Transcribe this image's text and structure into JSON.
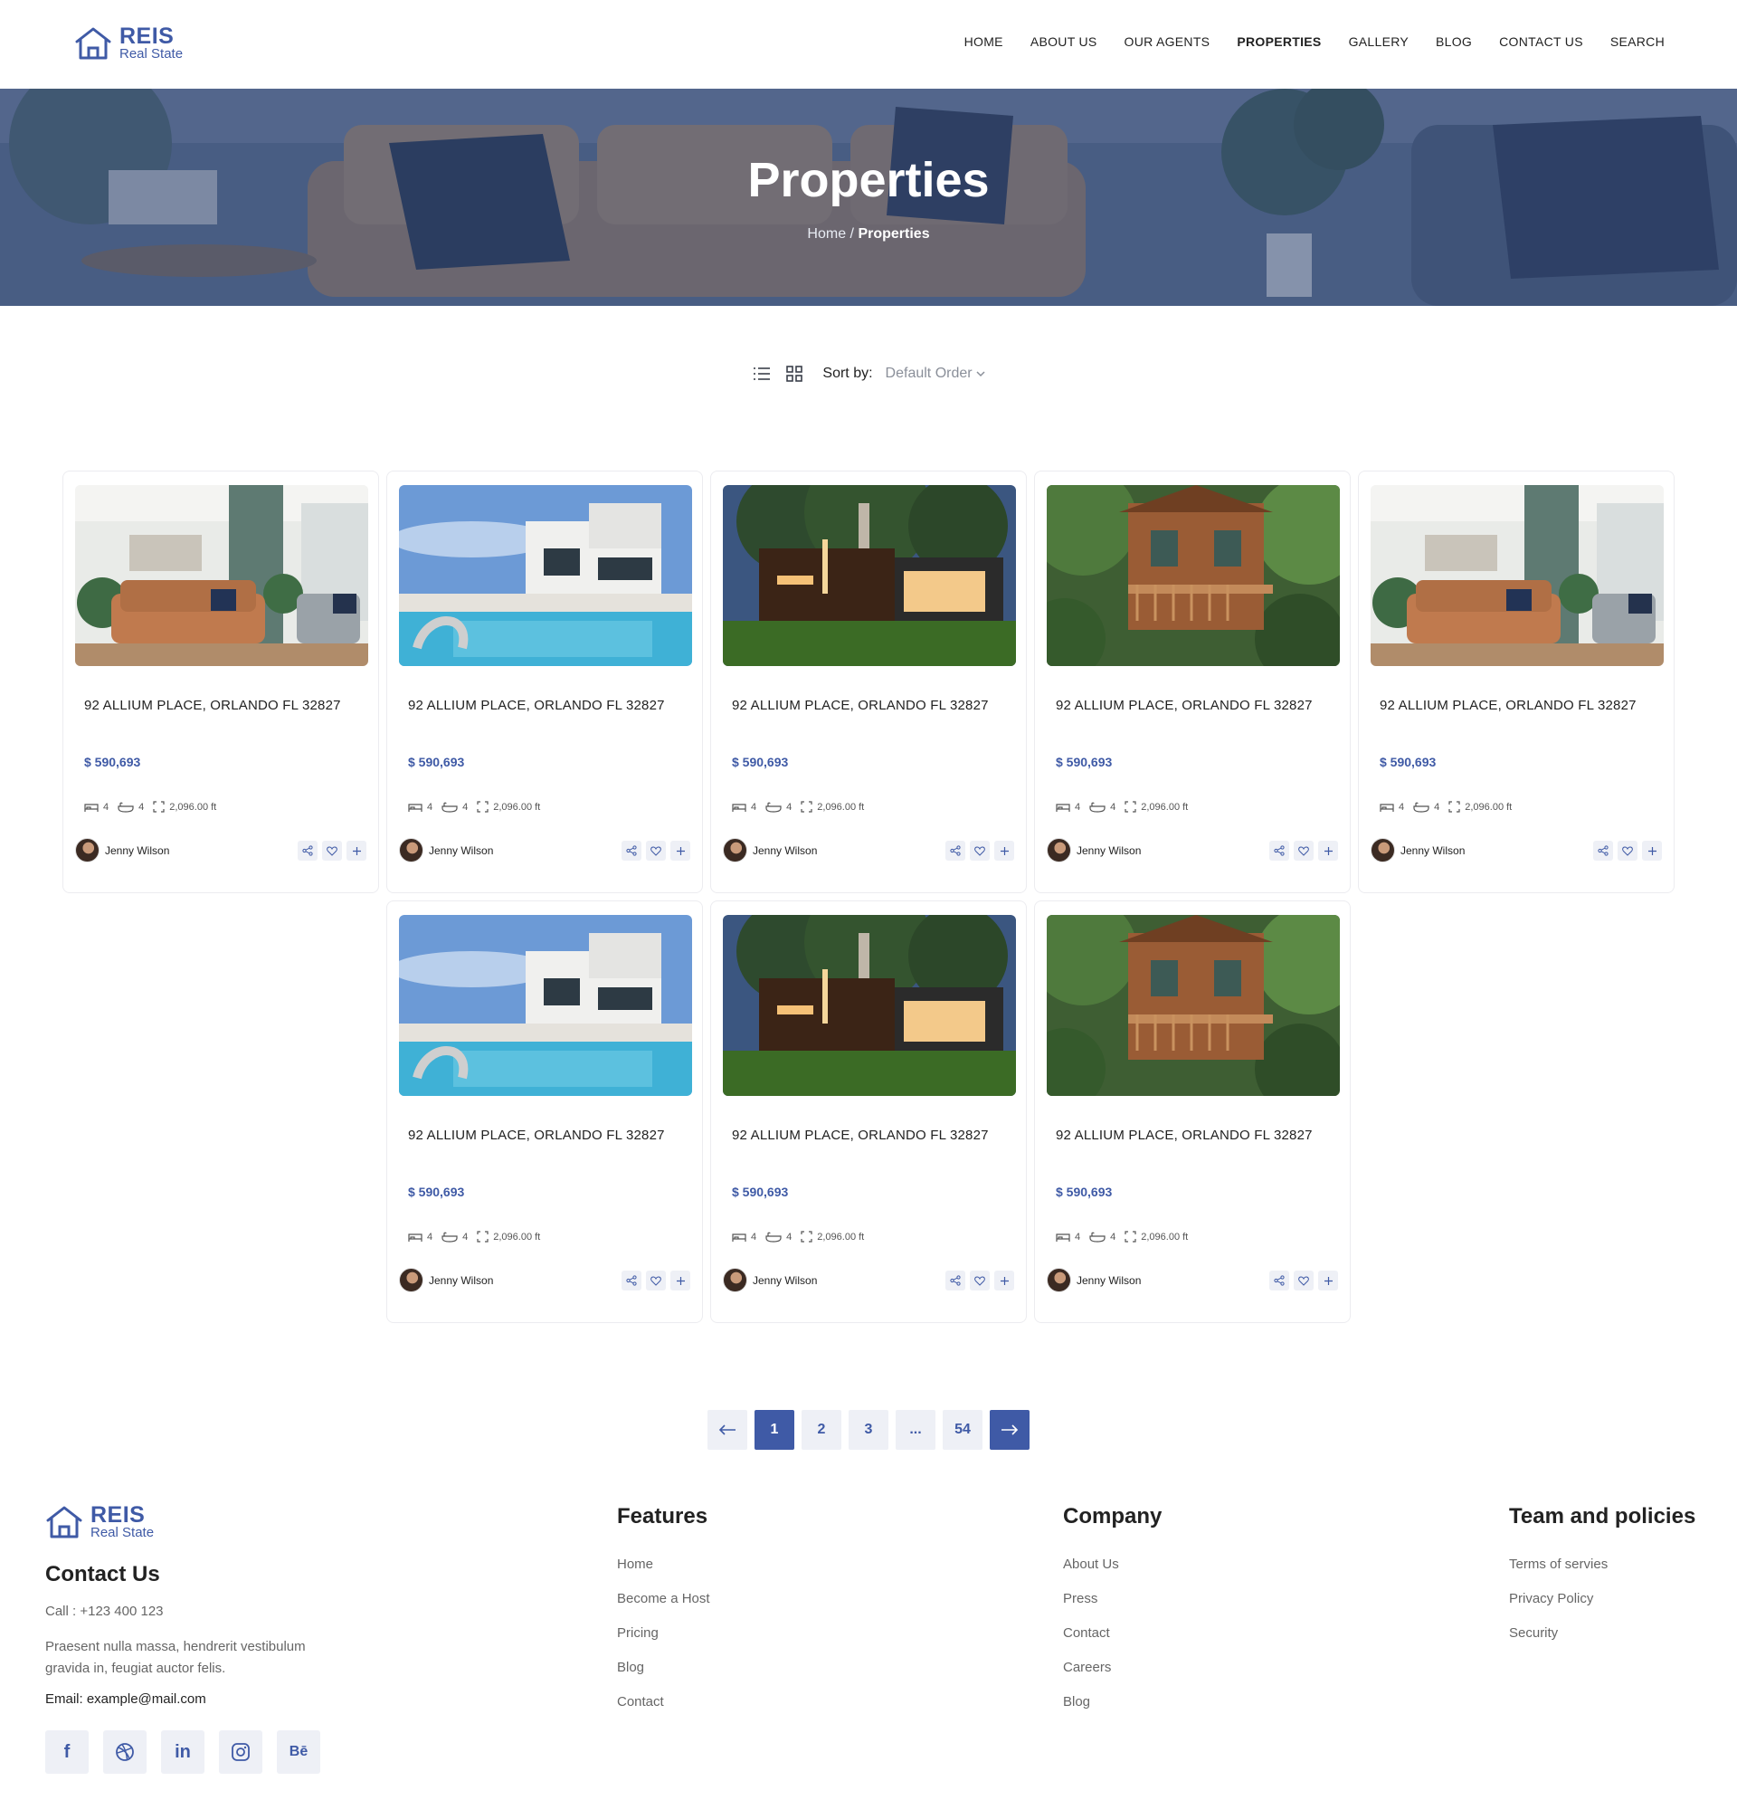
{
  "brand": {
    "name": "REIS",
    "tagline": "Real State",
    "accent": "#3f5aa6"
  },
  "nav": [
    {
      "label": "HOME"
    },
    {
      "label": "ABOUT US"
    },
    {
      "label": "OUR AGENTS"
    },
    {
      "label": "PROPERTIES",
      "active": true
    },
    {
      "label": "GALLERY"
    },
    {
      "label": "BLOG"
    },
    {
      "label": "CONTACT US"
    },
    {
      "label": "SEARCH"
    }
  ],
  "hero": {
    "title": "Properties",
    "breadcrumb_home": "Home",
    "breadcrumb_sep": "/",
    "breadcrumb_current": "Properties"
  },
  "toolbar": {
    "sort_label": "Sort by:",
    "sort_value": "Default Order"
  },
  "cards": [
    {
      "address": "92 ALLIUM PLACE, ORLANDO FL 32827",
      "price": "$ 590,693",
      "beds": "4",
      "baths": "4",
      "area": "2,096.00 ft",
      "agent": "Jenny Wilson",
      "image": "living-room"
    },
    {
      "address": "92 ALLIUM PLACE, ORLANDO FL 32827",
      "price": "$ 590,693",
      "beds": "4",
      "baths": "4",
      "area": "2,096.00 ft",
      "agent": "Jenny Wilson",
      "image": "pool-house"
    },
    {
      "address": "92 ALLIUM PLACE, ORLANDO FL 32827",
      "price": "$ 590,693",
      "beds": "4",
      "baths": "4",
      "area": "2,096.00 ft",
      "agent": "Jenny Wilson",
      "image": "modern-night-house"
    },
    {
      "address": "92 ALLIUM PLACE, ORLANDO FL 32827",
      "price": "$ 590,693",
      "beds": "4",
      "baths": "4",
      "area": "2,096.00 ft",
      "agent": "Jenny Wilson",
      "image": "forest-cabin"
    },
    {
      "address": "92 ALLIUM PLACE, ORLANDO FL 32827",
      "price": "$ 590,693",
      "beds": "4",
      "baths": "4",
      "area": "2,096.00 ft",
      "agent": "Jenny Wilson",
      "image": "living-room"
    },
    {
      "address": "92 ALLIUM PLACE, ORLANDO FL 32827",
      "price": "$ 590,693",
      "beds": "4",
      "baths": "4",
      "area": "2,096.00 ft",
      "agent": "Jenny Wilson",
      "image": "pool-house"
    },
    {
      "address": "92 ALLIUM PLACE, ORLANDO FL 32827",
      "price": "$ 590,693",
      "beds": "4",
      "baths": "4",
      "area": "2,096.00 ft",
      "agent": "Jenny Wilson",
      "image": "modern-night-house"
    },
    {
      "address": "92 ALLIUM PLACE, ORLANDO FL 32827",
      "price": "$ 590,693",
      "beds": "4",
      "baths": "4",
      "area": "2,096.00 ft",
      "agent": "Jenny Wilson",
      "image": "forest-cabin"
    }
  ],
  "pagination": {
    "prev_icon": "arrow-left-icon",
    "pages": [
      "1",
      "2",
      "3",
      "...",
      "54"
    ],
    "current": "1",
    "next_icon": "arrow-right-icon"
  },
  "footer": {
    "contact_title": "Contact Us",
    "call": "Call : +123 400 123",
    "description": "Praesent nulla massa, hendrerit vestibulum gravida in, feugiat auctor felis.",
    "email": "Email: example@mail.com",
    "socials": [
      "f",
      "dribbble",
      "in",
      "instagram",
      "Bē"
    ],
    "columns": [
      {
        "title": "Features",
        "links": [
          "Home",
          "Become a Host",
          "Pricing",
          "Blog",
          "Contact"
        ]
      },
      {
        "title": "Company",
        "links": [
          "About Us",
          "Press",
          "Contact",
          "Careers",
          "Blog"
        ]
      },
      {
        "title": "Team and policies",
        "links": [
          "Terms of servies",
          "Privacy Policy",
          "Security"
        ]
      }
    ]
  }
}
